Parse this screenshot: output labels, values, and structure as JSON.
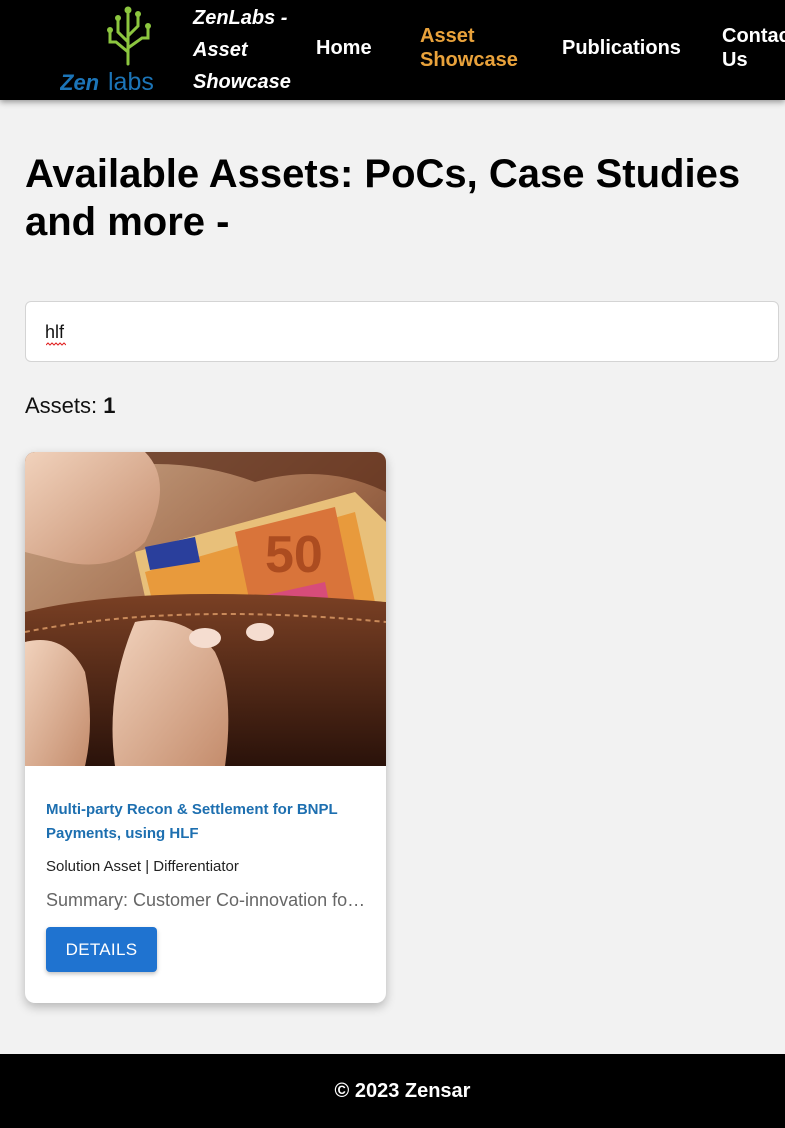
{
  "header": {
    "logo_text": {
      "zen": "Zen",
      "labs": "labs"
    },
    "site_title": "ZenLabs - Asset Showcase",
    "nav": [
      {
        "label": "Home",
        "active": false
      },
      {
        "label": "Asset Showcase",
        "active": true
      },
      {
        "label": "Publications",
        "active": false
      },
      {
        "label": "Contact Us",
        "active": false
      }
    ],
    "colors": {
      "background": "#000000",
      "active_nav": "#e9a23b",
      "logo_zen": "#1c75b8",
      "logo_tree": "#8cc63f"
    }
  },
  "main": {
    "heading": "Available Assets: PoCs, Case Studies and more -",
    "search": {
      "value": "hlf",
      "placeholder": ""
    },
    "assets_label": "Assets:",
    "assets_count": "1",
    "cards": [
      {
        "image": "euro-banknotes-wallet-photo",
        "title": "Multi-party Recon & Settlement for BNPL Payments, using HLF",
        "tags": "Solution Asset | Differentiator",
        "summary": "Summary: Customer Co-innovation for BNPL payments reconciliation",
        "button_label": "DETAILS"
      }
    ]
  },
  "footer": {
    "text": "© 2023 Zensar"
  },
  "colors": {
    "accent_button": "#1f73d0",
    "card_title": "#1d6fb0",
    "page_bg": "#f2f2f2"
  }
}
